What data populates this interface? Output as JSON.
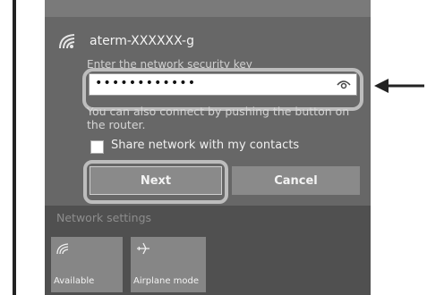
{
  "network": {
    "ssid": "aterm-XXXXXX-g",
    "key_label": "Enter the network security key",
    "password_mask": "••••••••••••",
    "help_text": "You can also connect by pushing the button on the router.",
    "share_label": "Share network with my contacts",
    "share_checked": false
  },
  "buttons": {
    "next": "Next",
    "cancel": "Cancel"
  },
  "network_settings_label": "Network settings",
  "quick_actions": [
    {
      "label": "Available",
      "icon": "wifi-icon"
    },
    {
      "label": "Airplane mode",
      "icon": "airplane-icon"
    }
  ],
  "colors": {
    "panel": "#505050",
    "item_bg": "#676767",
    "callout": "#bdbdbd"
  }
}
